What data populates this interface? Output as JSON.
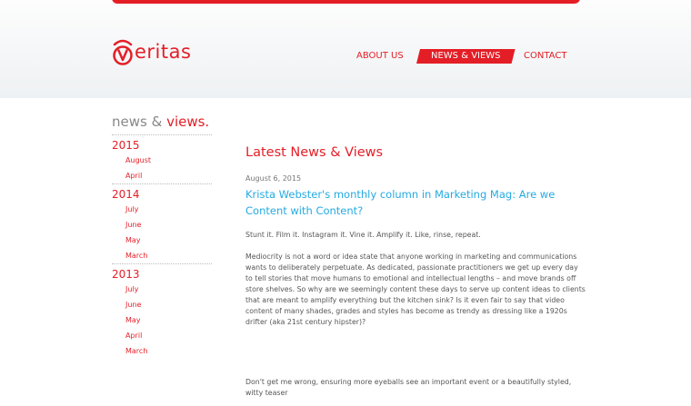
{
  "brand": {
    "logo_text": "eritas",
    "accent": "#e41e26",
    "link_color": "#25aae1"
  },
  "nav": {
    "items": [
      {
        "label": "ABOUT US",
        "active": false
      },
      {
        "label": "NEWS & VIEWS",
        "active": true
      },
      {
        "label": "CONTACT",
        "active": false
      }
    ]
  },
  "sidebar": {
    "title_part1": "news & ",
    "title_part2": "views.",
    "archive": [
      {
        "year": "2015",
        "months": [
          "August",
          "April"
        ]
      },
      {
        "year": "2014",
        "months": [
          "July",
          "June",
          "May",
          "March"
        ]
      },
      {
        "year": "2013",
        "months": [
          "July",
          "June",
          "May",
          "April",
          "March"
        ]
      }
    ]
  },
  "main": {
    "heading": "Latest News & Views",
    "post": {
      "date": "August 6, 2015",
      "title": "Krista Webster's monthly column in Marketing Mag: Are we Content with Content?",
      "paragraphs": [
        "Stunt it. Film it. Instagram it. Vine it. Amplify it. Like, rinse, repeat.",
        "Mediocrity is not a word or idea state that anyone working in marketing and communications wants to deliberately perpetuate. As dedicated, passionate practitioners we get up every day to tell stories that move humans to emotional and intellectual lengths – and move brands off store shelves. So why are we seemingly content these days to serve up content ideas to clients that are meant to amplify everything but the kitchen sink? Is it even fair to say that video content of many shades, grades and styles has become as trendy as dressing like a 1920s drifter (aka 21st century hipster)?",
        "Don't get me wrong, ensuring more eyeballs see an important event or a beautifully styled, witty teaser"
      ]
    }
  }
}
